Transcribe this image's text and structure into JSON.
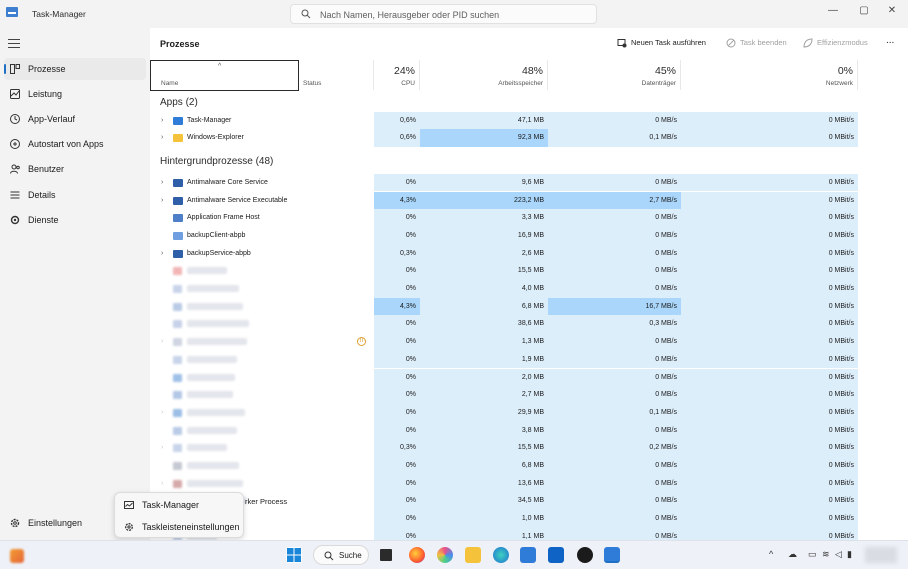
{
  "window": {
    "title": "Task-Manager",
    "search_placeholder": "Nach Namen, Herausgeber oder PID suchen",
    "controls": {
      "minimize": "—",
      "maximize": "▢",
      "close": "✕"
    }
  },
  "sidebar": {
    "items": [
      {
        "label": "Prozesse",
        "icon": "processes-icon",
        "active": true
      },
      {
        "label": "Leistung",
        "icon": "performance-icon"
      },
      {
        "label": "App-Verlauf",
        "icon": "history-icon"
      },
      {
        "label": "Autostart von Apps",
        "icon": "startup-icon"
      },
      {
        "label": "Benutzer",
        "icon": "users-icon"
      },
      {
        "label": "Details",
        "icon": "details-icon"
      },
      {
        "label": "Dienste",
        "icon": "services-icon"
      }
    ],
    "settings_label": "Einstellungen"
  },
  "toolbar": {
    "title": "Prozesse",
    "new_task": "Neuen Task ausführen",
    "end_task": "Task beenden",
    "efficiency": "Effizienzmodus",
    "more": "..."
  },
  "columns": {
    "name": "Name",
    "status": "Status",
    "cpu": {
      "pct": "24%",
      "label": "CPU"
    },
    "memory": {
      "pct": "48%",
      "label": "Arbeitsspeicher"
    },
    "disk": {
      "pct": "45%",
      "label": "Datenträger"
    },
    "network": {
      "pct": "0%",
      "label": "Netzwerk"
    }
  },
  "groups": {
    "apps": "Apps (2)",
    "background": "Hintergrundprozesse (48)"
  },
  "processes": {
    "apps": [
      {
        "name": "Task-Manager",
        "cpu": "0,6%",
        "mem": "47,1 MB",
        "disk": "0 MB/s",
        "net": "0 MBit/s"
      },
      {
        "name": "Windows-Explorer",
        "cpu": "0,6%",
        "mem": "92,3 MB",
        "disk": "0,1 MB/s",
        "net": "0 MBit/s"
      }
    ],
    "background": [
      {
        "name": "Antimalware Core Service",
        "cpu": "0%",
        "mem": "9,6 MB",
        "disk": "0 MB/s",
        "net": "0 MBit/s"
      },
      {
        "name": "Antimalware Service Executable",
        "cpu": "4,3%",
        "mem": "223,2 MB",
        "disk": "2,7 MB/s",
        "net": "0 MBit/s"
      },
      {
        "name": "Application Frame Host",
        "cpu": "0%",
        "mem": "3,3 MB",
        "disk": "0 MB/s",
        "net": "0 MBit/s"
      },
      {
        "name": "backupClient-abpb",
        "cpu": "0%",
        "mem": "16,9 MB",
        "disk": "0 MB/s",
        "net": "0 MBit/s"
      },
      {
        "name": "backupService-abpb",
        "cpu": "0,3%",
        "mem": "2,6 MB",
        "disk": "0 MB/s",
        "net": "0 MBit/s"
      },
      {
        "name": "",
        "cpu": "0%",
        "mem": "15,5 MB",
        "disk": "0 MB/s",
        "net": "0 MBit/s"
      },
      {
        "name": "",
        "cpu": "0%",
        "mem": "4,0 MB",
        "disk": "0 MB/s",
        "net": "0 MBit/s"
      },
      {
        "name": "",
        "cpu": "4,3%",
        "mem": "6,8 MB",
        "disk": "16,7 MB/s",
        "net": "0 MBit/s"
      },
      {
        "name": "",
        "cpu": "0%",
        "mem": "38,6 MB",
        "disk": "0,3 MB/s",
        "net": "0 MBit/s"
      },
      {
        "name": "",
        "cpu": "0%",
        "mem": "1,3 MB",
        "disk": "0 MB/s",
        "net": "0 MBit/s"
      },
      {
        "name": "",
        "cpu": "0%",
        "mem": "1,9 MB",
        "disk": "0 MB/s",
        "net": "0 MBit/s"
      },
      {
        "name": "",
        "cpu": "0%",
        "mem": "2,0 MB",
        "disk": "0 MB/s",
        "net": "0 MBit/s"
      },
      {
        "name": "",
        "cpu": "0%",
        "mem": "2,7 MB",
        "disk": "0 MB/s",
        "net": "0 MBit/s"
      },
      {
        "name": "",
        "cpu": "0%",
        "mem": "29,9 MB",
        "disk": "0,1 MB/s",
        "net": "0 MBit/s"
      },
      {
        "name": "",
        "cpu": "0%",
        "mem": "3,8 MB",
        "disk": "0 MB/s",
        "net": "0 MBit/s"
      },
      {
        "name": "",
        "cpu": "0,3%",
        "mem": "15,5 MB",
        "disk": "0,2 MB/s",
        "net": "0 MBit/s"
      },
      {
        "name": "",
        "cpu": "0%",
        "mem": "6,8 MB",
        "disk": "0 MB/s",
        "net": "0 MBit/s"
      },
      {
        "name": "",
        "cpu": "0%",
        "mem": "13,6 MB",
        "disk": "0 MB/s",
        "net": "0 MBit/s"
      },
      {
        "name": "",
        "cpu": "0%",
        "mem": "34,5 MB",
        "disk": "0 MB/s",
        "net": "0 MBit/s"
      },
      {
        "name": "",
        "cpu": "0%",
        "mem": "1,0 MB",
        "disk": "0 MB/s",
        "net": "0 MBit/s"
      },
      {
        "name": "",
        "cpu": "0%",
        "mem": "1,1 MB",
        "disk": "0 MB/s",
        "net": "0 MBit/s"
      }
    ]
  },
  "popup": {
    "items": [
      {
        "label": "Task-Manager",
        "icon": "task-manager-icon"
      },
      {
        "label": "Taskleisteneinstellungen",
        "icon": "gear-icon"
      }
    ],
    "overflow_text": "rker Process"
  },
  "taskbar": {
    "search_label": "Suche"
  },
  "colors": {
    "cell_light": "#ddeefb",
    "cell_mid": "#c4e3fb",
    "cell_strong": "#a9d6fa",
    "accent": "#1f6fc4"
  }
}
